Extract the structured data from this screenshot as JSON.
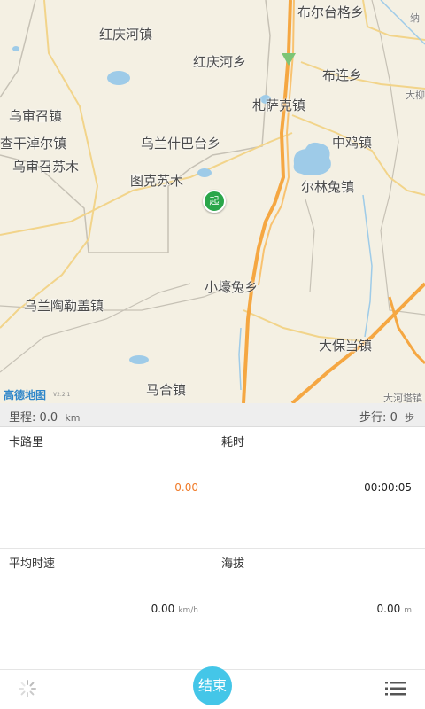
{
  "map": {
    "places": [
      "布尔台格乡",
      "纳",
      "红庆河镇",
      "红庆河乡",
      "布连乡",
      "大柳",
      "乌审召镇",
      "札萨克镇",
      "查干淖尔镇",
      "乌兰什巴台乡",
      "中鸡镇",
      "乌审召苏木",
      "图克苏木",
      "尔林兔镇",
      "小壕兔乡",
      "乌兰陶勒盖镇",
      "大保当镇",
      "马合镇",
      "大河塔镇"
    ],
    "logo": "高德地图",
    "logo_version": "V2.2.1",
    "start_marker": "起"
  },
  "stats": {
    "mileage_label": "里程:",
    "mileage_value": "0.0",
    "mileage_unit": "km",
    "steps_label": "步行:",
    "steps_value": "0",
    "steps_unit": "步"
  },
  "metrics": {
    "calories": {
      "label": "卡路里",
      "value": "0.00"
    },
    "duration": {
      "label": "耗时",
      "value": "00:00:05"
    },
    "avg_speed": {
      "label": "平均时速",
      "value": "0.00",
      "unit": "km/h"
    },
    "altitude": {
      "label": "海拔",
      "value": "0.00",
      "unit": "m"
    }
  },
  "bottom": {
    "end_label": "结束",
    "left_icon": "loading-spinner-icon",
    "right_icon": "list-menu-icon"
  },
  "colors": {
    "map_bg": "#f4f0e3",
    "water": "#9ecbe8",
    "highway": "#f5a742",
    "road": "#f2cd7e",
    "calorie_value": "#f07a28",
    "end_button": "#44c6e8",
    "marker": "#2aa64a"
  }
}
